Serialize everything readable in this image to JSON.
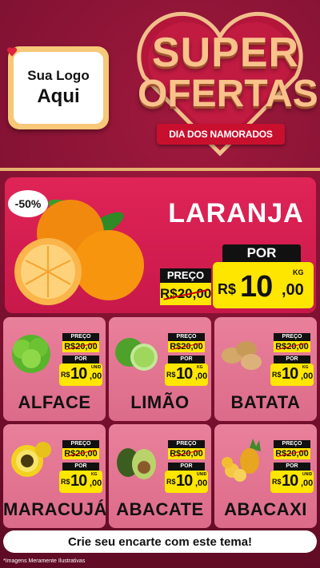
{
  "logo": {
    "line1": "Sua Logo",
    "line2": "Aqui"
  },
  "hero": {
    "title_line1": "SUPER",
    "title_line2": "OFERTAS",
    "subtitle": "DIA DOS NAMORADOS"
  },
  "featured": {
    "discount": "-50%",
    "name": "LARANJA",
    "preco_label": "PREÇO",
    "old_price": "R$20,00",
    "por_label": "POR",
    "currency": "R$",
    "price_int": "10",
    "price_dec": ",00",
    "unit": "KG",
    "icon": "orange-icon"
  },
  "products": [
    {
      "name": "ALFACE",
      "preco_label": "PREÇO",
      "old_price": "R$20,00",
      "por_label": "POR",
      "currency": "R$",
      "price_int": "10",
      "price_dec": ",00",
      "unit": "UNID",
      "icon": "lettuce-icon"
    },
    {
      "name": "LIMÃO",
      "preco_label": "PREÇO",
      "old_price": "R$20,00",
      "por_label": "POR",
      "currency": "R$",
      "price_int": "10",
      "price_dec": ",00",
      "unit": "KG",
      "icon": "lime-icon"
    },
    {
      "name": "BATATA",
      "preco_label": "PREÇO",
      "old_price": "R$20,00",
      "por_label": "POR",
      "currency": "R$",
      "price_int": "10",
      "price_dec": ",00",
      "unit": "KG",
      "icon": "potato-icon"
    },
    {
      "name": "MARACUJÁ",
      "preco_label": "PREÇO",
      "old_price": "R$20,00",
      "por_label": "POR",
      "currency": "R$",
      "price_int": "10",
      "price_dec": ",00",
      "unit": "KG",
      "icon": "passion-fruit-icon"
    },
    {
      "name": "ABACATE",
      "preco_label": "PREÇO",
      "old_price": "R$20,00",
      "por_label": "POR",
      "currency": "R$",
      "price_int": "10",
      "price_dec": ",00",
      "unit": "UNID",
      "icon": "avocado-icon"
    },
    {
      "name": "ABACAXI",
      "preco_label": "PREÇO",
      "old_price": "R$20,00",
      "por_label": "POR",
      "currency": "R$",
      "price_int": "10",
      "price_dec": ",00",
      "unit": "UNID",
      "icon": "pineapple-icon"
    }
  ],
  "banner": "Crie seu encarte com este tema!",
  "disclaimer": "*Imagens Meramente Ilustrativas",
  "colors": {
    "background": "#7d1230",
    "featured": "#e02457",
    "card": "#e9809b",
    "price_tag": "#ffe600",
    "gold": "#e6b16f"
  }
}
